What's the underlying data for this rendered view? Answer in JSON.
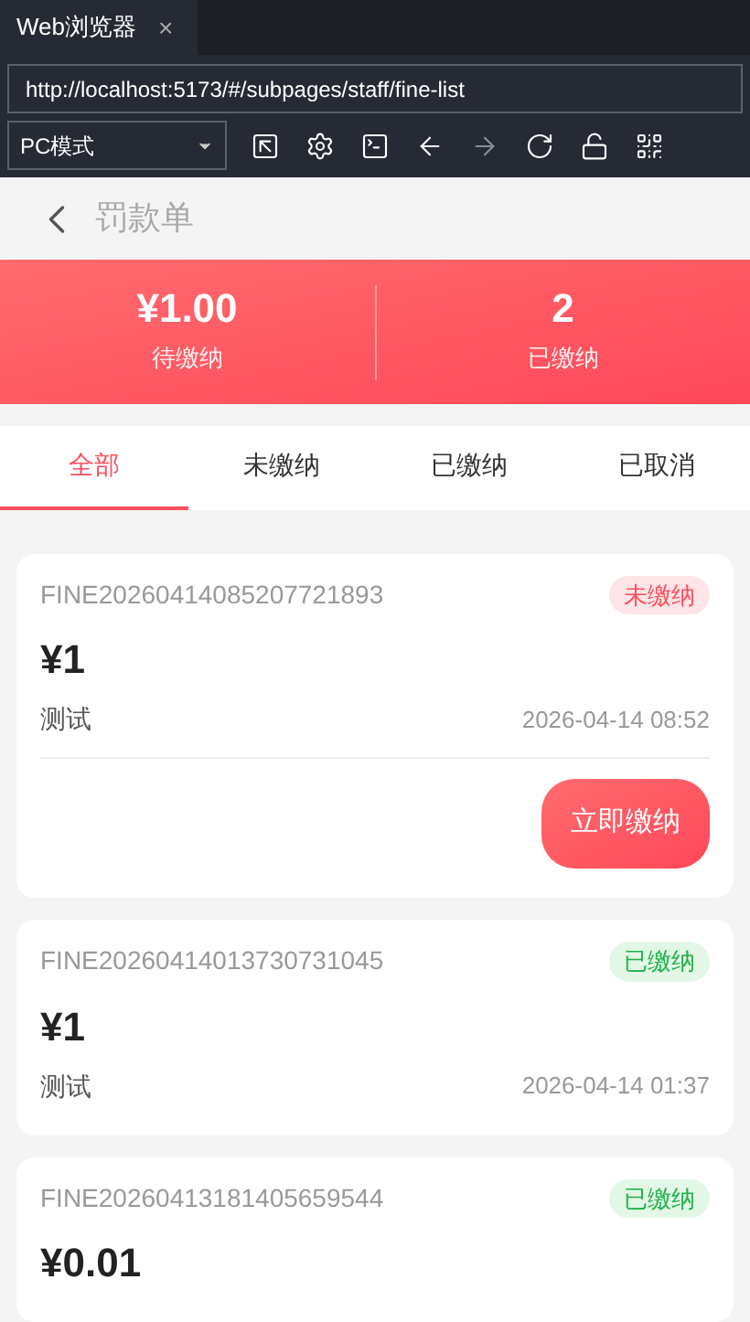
{
  "browser_tab": {
    "title": "Web浏览器",
    "close": "×"
  },
  "address_bar": {
    "value": "http://localhost:5173/#/subpages/staff/fine-list"
  },
  "mode_select": {
    "value": "PC模式"
  },
  "toolbar": [
    {
      "kind": "resize",
      "disabled": false
    },
    {
      "kind": "settings",
      "disabled": false
    },
    {
      "kind": "terminal",
      "disabled": false
    },
    {
      "kind": "back",
      "disabled": false
    },
    {
      "kind": "forward",
      "disabled": true
    },
    {
      "kind": "reload",
      "disabled": false
    },
    {
      "kind": "unlock",
      "disabled": false
    },
    {
      "kind": "qrcode",
      "disabled": false
    }
  ],
  "header": {
    "title": "罚款单"
  },
  "stats": [
    {
      "value": "¥1.00",
      "label": "待缴纳"
    },
    {
      "value": "2",
      "label": "已缴纳"
    }
  ],
  "tabs": [
    {
      "label": "全部",
      "selected": true
    },
    {
      "label": "未缴纳",
      "selected": false
    },
    {
      "label": "已缴纳",
      "selected": false
    },
    {
      "label": "已取消",
      "selected": false
    }
  ],
  "fines": [
    {
      "number": "FINE20260414085207721893",
      "status": {
        "label": "未缴纳",
        "kind": "unpaid"
      },
      "amount": "¥1",
      "reason": "测试",
      "time": "2026-04-14 08:52",
      "action": "立即缴纳"
    },
    {
      "number": "FINE20260414013730731045",
      "status": {
        "label": "已缴纳",
        "kind": "paid"
      },
      "amount": "¥1",
      "reason": "测试",
      "time": "2026-04-14 01:37"
    },
    {
      "number": "FINE20260413181405659544",
      "status": {
        "label": "已缴纳",
        "kind": "paid"
      },
      "amount": "¥0.01"
    }
  ]
}
